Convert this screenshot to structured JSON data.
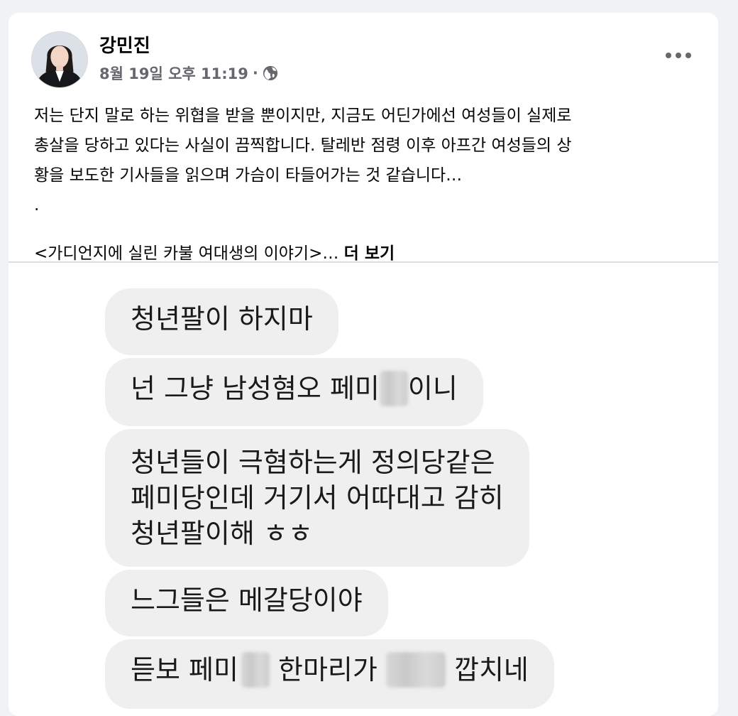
{
  "post": {
    "author": "강민진",
    "date": "8월 19일 오후 11:19",
    "separator": "·",
    "privacy_icon": "globe-icon",
    "more_icon": "more-options-icon",
    "text_lines": [
      "저는 단지 말로 하는 위협을 받을 뿐이지만, 지금도 어딘가에선 여성들이 실제로",
      "총살을 당하고 있다는 사실이 끔찍합니다. 탈레반 점령 이후 아프간 여성들의 상",
      "황을 보도한 기사들을 읽으며 가슴이 타들어가는 것 같습니다…",
      "."
    ],
    "tail_text": "<가디언지에 실린 카불 여대생의 이야기>…",
    "see_more": "더 보기"
  },
  "messages": [
    {
      "parts": [
        "청년팔이 하지마"
      ]
    },
    {
      "parts": [
        "넌 그냥 남성혐오 페미",
        "",
        "이니"
      ]
    },
    {
      "lines": [
        "청년들이 극혐하는게 정의당같은",
        "페미당인데 거기서 어따대고 감히",
        "청년팔이해 ㅎㅎ"
      ]
    },
    {
      "parts": [
        "느그들은 메갈당이야"
      ]
    },
    {
      "parts": [
        "듣보 페미",
        "",
        " 한마리가 ",
        "",
        " 깝치네"
      ]
    }
  ],
  "colors": {
    "background": "#f0f2f5",
    "card": "#ffffff",
    "bubble": "#efefef",
    "secondary_text": "#65676b"
  }
}
